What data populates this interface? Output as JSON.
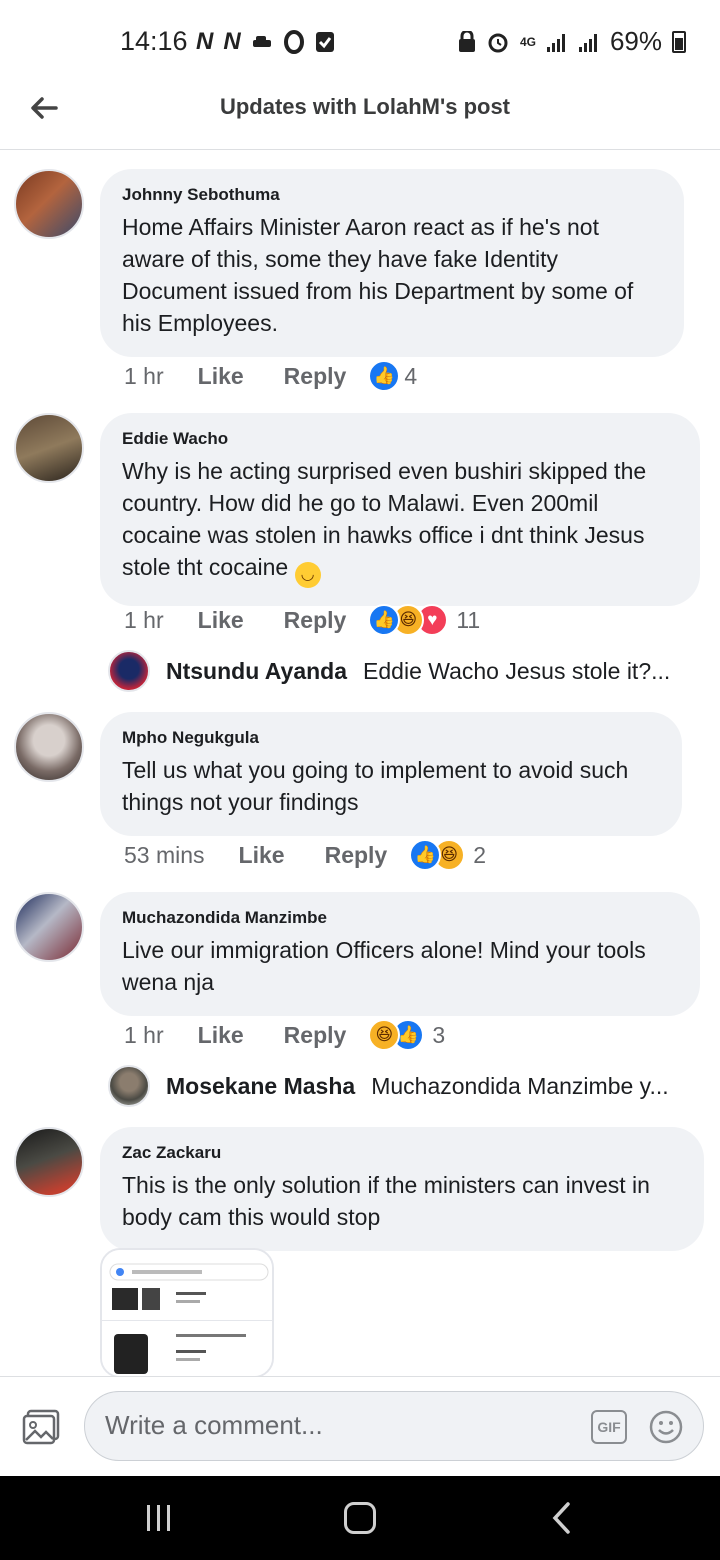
{
  "status_bar": {
    "time": "14:16",
    "network": "4G",
    "battery": "69%"
  },
  "header": {
    "title": "Updates with LolahM's post"
  },
  "comments": [
    {
      "author": "Johnny Sebothuma",
      "text": "Home Affairs Minister Aaron react as if he's not aware of this, some they have fake Identity Document issued from his Department by some of his Employees.",
      "time": "1 hr",
      "like": "Like",
      "reply": "Reply",
      "reaction_count": "4"
    },
    {
      "author": "Eddie Wacho",
      "text": "Why is he acting surprised even bushiri skipped the country. How did he go to Malawi. Even 200mil cocaine was stolen in hawks office i dnt think Jesus stole tht cocaine",
      "time": "1 hr",
      "like": "Like",
      "reply": "Reply",
      "reaction_count": "11",
      "reply_preview": {
        "author": "Ntsundu Ayanda",
        "text": "Eddie Wacho Jesus stole it?..."
      }
    },
    {
      "author": "Mpho Negukgula",
      "text": "Tell us what you going to implement to avoid such things not your findings",
      "time": "53 mins",
      "like": "Like",
      "reply": "Reply",
      "reaction_count": "2"
    },
    {
      "author": "Muchazondida Manzimbe",
      "text": "Live our immigration Officers alone! Mind your tools wena nja",
      "time": "1 hr",
      "like": "Like",
      "reply": "Reply",
      "reaction_count": "3",
      "reply_preview": {
        "author": "Mosekane Masha",
        "text": "Muchazondida Manzimbe y..."
      }
    },
    {
      "author": "Zac Zackaru",
      "text": "This is the only solution if the ministers can invest in body cam this would stop"
    }
  ],
  "composer": {
    "placeholder": "Write a comment...",
    "gif_label": "GIF"
  },
  "colors": {
    "bubble": "#f0f2f5",
    "like_blue": "#1877f2",
    "haha_yellow": "#f7b125",
    "love_red": "#f33e58"
  }
}
